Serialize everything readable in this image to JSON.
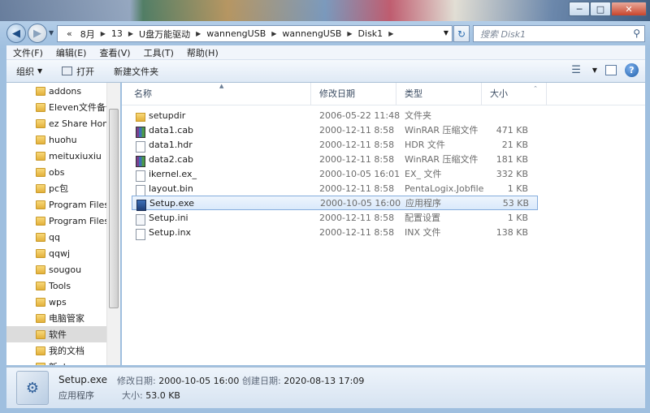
{
  "window": {
    "minimize": "─",
    "maximize": "□",
    "close": "✕"
  },
  "address": {
    "overflow": "«",
    "crumbs": [
      "8月",
      "13",
      "U盘万能驱动",
      "wannengUSB",
      "wannengUSB",
      "Disk1"
    ],
    "search_placeholder": "搜索 Disk1"
  },
  "menu": [
    "文件(F)",
    "编辑(E)",
    "查看(V)",
    "工具(T)",
    "帮助(H)"
  ],
  "toolbar": {
    "organize": "组织",
    "open": "打开",
    "new_folder": "新建文件夹"
  },
  "nav": {
    "items": [
      {
        "label": "addons"
      },
      {
        "label": "Eleven文件备份"
      },
      {
        "label": "ez Share Hom"
      },
      {
        "label": "huohu"
      },
      {
        "label": "meituxiuxiu"
      },
      {
        "label": "obs"
      },
      {
        "label": "pc包"
      },
      {
        "label": "Program Files"
      },
      {
        "label": "Program Files"
      },
      {
        "label": "qq"
      },
      {
        "label": "qqwj"
      },
      {
        "label": "sougou"
      },
      {
        "label": "Tools"
      },
      {
        "label": "wps"
      },
      {
        "label": "电脑管家"
      },
      {
        "label": "软件"
      },
      {
        "label": "我的文档"
      },
      {
        "label": "新ebs"
      }
    ],
    "selected_index": 15
  },
  "columns": {
    "name": "名称",
    "date": "修改日期",
    "type": "类型",
    "size": "大小"
  },
  "files": [
    {
      "name": "setupdir",
      "date": "2006-05-22 11:48",
      "type": "文件夹",
      "size": "",
      "icon": "folder-icon"
    },
    {
      "name": "data1.cab",
      "date": "2000-12-11 8:58",
      "type": "WinRAR 压缩文件",
      "size": "471 KB",
      "icon": "rar-icon"
    },
    {
      "name": "data1.hdr",
      "date": "2000-12-11 8:58",
      "type": "HDR 文件",
      "size": "21 KB",
      "icon": "document-icon"
    },
    {
      "name": "data2.cab",
      "date": "2000-12-11 8:58",
      "type": "WinRAR 压缩文件",
      "size": "181 KB",
      "icon": "rar-icon"
    },
    {
      "name": "ikernel.ex_",
      "date": "2000-10-05 16:01",
      "type": "EX_ 文件",
      "size": "332 KB",
      "icon": "document-icon"
    },
    {
      "name": "layout.bin",
      "date": "2000-12-11 8:58",
      "type": "PentaLogix.Jobfile",
      "size": "1 KB",
      "icon": "document-icon"
    },
    {
      "name": "Setup.exe",
      "date": "2000-10-05 16:00",
      "type": "应用程序",
      "size": "53 KB",
      "icon": "setup-exe-icon"
    },
    {
      "name": "Setup.ini",
      "date": "2000-12-11 8:58",
      "type": "配置设置",
      "size": "1 KB",
      "icon": "ini-settings-icon"
    },
    {
      "name": "Setup.inx",
      "date": "2000-12-11 8:58",
      "type": "INX 文件",
      "size": "138 KB",
      "icon": "document-icon"
    }
  ],
  "selected_file_index": 6,
  "details": {
    "name": "Setup.exe",
    "type": "应用程序",
    "modified_label": "修改日期:",
    "modified_value": "2000-10-05 16:00",
    "size_label": "大小:",
    "size_value": "53.0 KB",
    "created_label": "创建日期:",
    "created_value": "2020-08-13 17:09"
  }
}
